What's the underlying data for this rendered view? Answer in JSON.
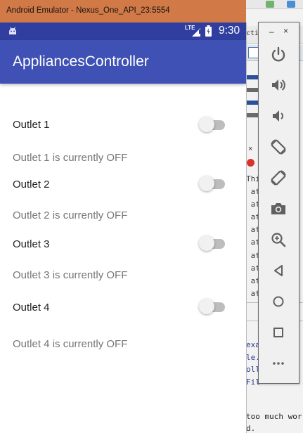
{
  "window": {
    "title": "Android Emulator - Nexus_One_API_23:5554"
  },
  "statusbar": {
    "time": "9:30",
    "network": "LTE",
    "icons": [
      "android-icon",
      "signal-icon",
      "battery-icon"
    ]
  },
  "app": {
    "title": "AppliancesController"
  },
  "outlets": [
    {
      "label": "Outlet 1",
      "status": "Outlet 1 is currently OFF",
      "on": false
    },
    {
      "label": "Outlet 2",
      "status": "Outlet 2 is currently OFF",
      "on": false
    },
    {
      "label": "Outlet 3",
      "status": "Outlet 3 is currently OFF",
      "on": false
    },
    {
      "label": "Outlet 4",
      "status": "Outlet 4 is currently OFF",
      "on": false
    }
  ],
  "toolbar": {
    "minimize": "–",
    "close": "×",
    "buttons": [
      "power-icon",
      "volume-up-icon",
      "volume-down-icon",
      "rotate-left-icon",
      "rotate-right-icon",
      "camera-icon",
      "zoom-icon",
      "back-icon",
      "home-icon",
      "overview-icon",
      "more-icon"
    ]
  },
  "background_ide": {
    "tab_text": "ctiv",
    "error_head": "Thi",
    "stack_lines": [
      "at",
      "at",
      "at",
      "at",
      "at",
      "at",
      "at",
      "at",
      "at"
    ],
    "lower_lines": [
      "exa",
      "le.",
      "oll",
      "Fil"
    ],
    "bottom_lines": [
      "too much wor",
      "d."
    ]
  },
  "colors": {
    "titlebar": "#d17a47",
    "statusbar": "#303f9f",
    "appbar": "#3f51b5",
    "switch_track_off": "#bdbdbd",
    "switch_thumb_off": "#f1f1f1"
  }
}
